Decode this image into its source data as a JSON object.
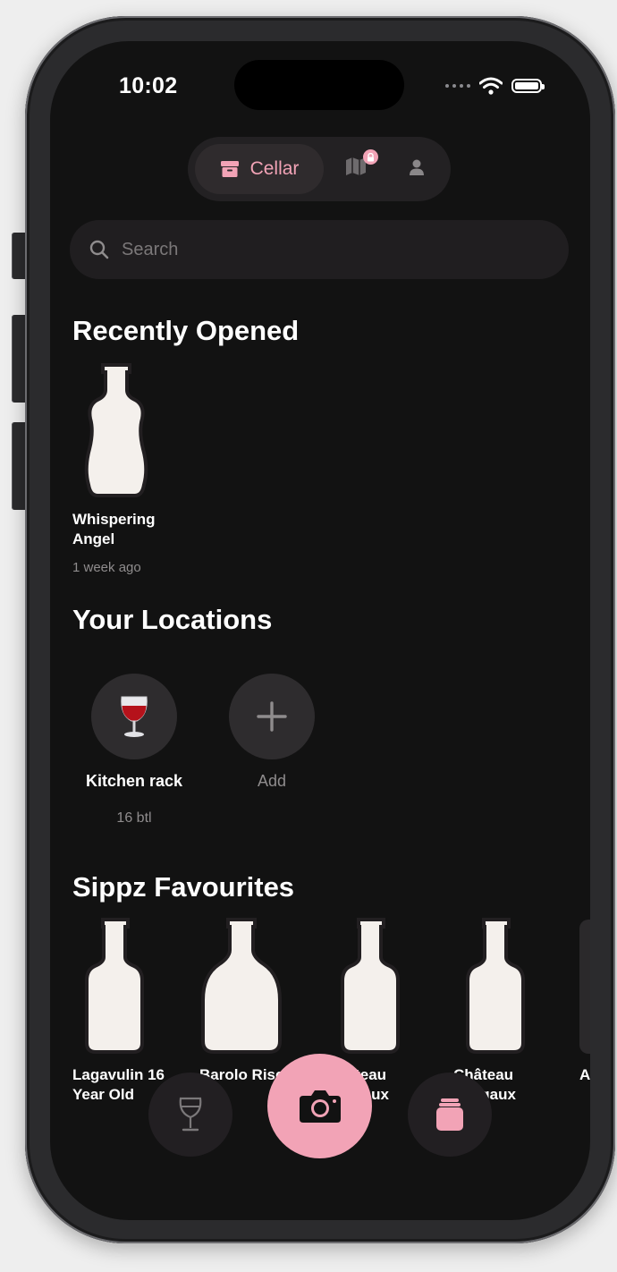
{
  "status_bar": {
    "time": "10:02"
  },
  "topnav": {
    "cellar_label": "Cellar",
    "accent_color": "#f2a3b6"
  },
  "search": {
    "placeholder": "Search"
  },
  "recently_opened": {
    "title": "Recently Opened",
    "items": [
      {
        "name": "Whispering Angel",
        "time_ago": "1 week ago"
      }
    ]
  },
  "locations": {
    "title": "Your Locations",
    "items": [
      {
        "name": "Kitchen rack",
        "count": "16 btl",
        "icon": "wine-glass-emoji"
      }
    ],
    "add_label": "Add"
  },
  "favourites": {
    "title": "Sippz Favourites",
    "items": [
      {
        "name": "Lagavulin 16 Year Old"
      },
      {
        "name": "Barolo Riserva"
      },
      {
        "name": "Château Margaux"
      },
      {
        "name": "Château Margaux"
      },
      {
        "name": "A"
      }
    ]
  },
  "bottom_bar": {
    "left_icon": "wine-glass-icon",
    "center_icon": "camera-icon",
    "right_icon": "jar-icon"
  }
}
